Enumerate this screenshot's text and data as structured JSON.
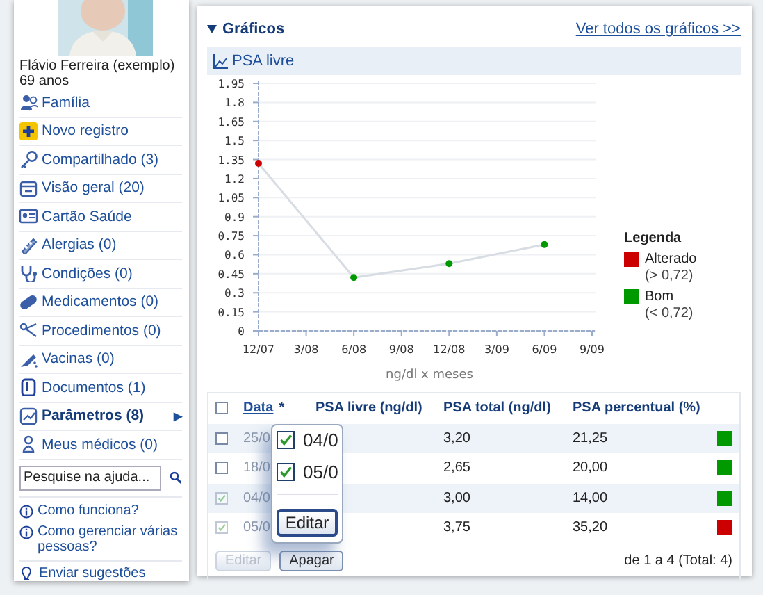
{
  "profile": {
    "name": "Flávio Ferreira (exemplo)",
    "age": "69 anos"
  },
  "nav": [
    {
      "label": "Família",
      "selected": false
    },
    {
      "label": "Novo registro",
      "selected": false
    },
    {
      "label": "Compartilhado (3)",
      "selected": false
    },
    {
      "label": "Visão geral (20)",
      "selected": false
    },
    {
      "label": "Cartão Saúde",
      "selected": false
    },
    {
      "label": "Alergias (0)",
      "selected": false
    },
    {
      "label": "Condições (0)",
      "selected": false
    },
    {
      "label": "Medicamentos (0)",
      "selected": false
    },
    {
      "label": "Procedimentos (0)",
      "selected": false
    },
    {
      "label": "Vacinas (0)",
      "selected": false
    },
    {
      "label": "Documentos (1)",
      "selected": false
    },
    {
      "label": "Parâmetros (8)",
      "selected": true,
      "marker": "▶"
    },
    {
      "label": "Meus médicos (0)",
      "selected": false
    }
  ],
  "help_search": {
    "placeholder": "Pesquise na ajuda..."
  },
  "help_links": [
    "Como funciona?",
    "Como gerenciar várias pessoas?"
  ],
  "feedback_link": "Enviar sugestões",
  "section": {
    "title": "Gráficos",
    "expanded": true,
    "link": "Ver todos os gráficos >>"
  },
  "chart": {
    "chart_data": {
      "type": "line",
      "xlabel": "ng/dl x meses",
      "grid": true,
      "categories": [
        "12/07",
        "3/08",
        "6/08",
        "9/08",
        "12/08",
        "3/09",
        "6/09",
        "9/09"
      ],
      "series": [
        {
          "name": "PSA livre",
          "color": "#d8dde4",
          "marker": true,
          "values": [
            1.32,
            null,
            0.42,
            null,
            0.53,
            null,
            0.68,
            null
          ]
        }
      ],
      "ylim": [
        0,
        1.95
      ],
      "yticks": [
        {
          "value": 0,
          "label": "0"
        },
        {
          "value": 0.15,
          "label": "0.15"
        },
        {
          "value": 0.3,
          "label": "0.3"
        },
        {
          "value": 0.45,
          "label": "0.45"
        },
        {
          "value": 0.6,
          "label": "0.6"
        },
        {
          "value": 0.75,
          "label": "0.75"
        },
        {
          "value": 0.9,
          "label": "0.9"
        },
        {
          "value": 1.05,
          "label": "1.05"
        },
        {
          "value": 1.2,
          "label": "1.2"
        },
        {
          "value": 1.35,
          "label": "1.35"
        },
        {
          "value": 1.5,
          "label": "1.5"
        },
        {
          "value": 1.65,
          "label": "1.65"
        },
        {
          "value": 1.8,
          "label": "1.8"
        },
        {
          "value": 1.95,
          "label": "1.95"
        }
      ]
    },
    "points": [
      {
        "kind": "altered"
      },
      {
        "kind": "good"
      },
      {
        "kind": "good"
      },
      {
        "kind": "good"
      }
    ],
    "legend": {
      "title": "Legenda",
      "items": [
        {
          "kind": "altered",
          "label": "Alterado",
          "note": "(> 0,72)",
          "color": "#cc0000"
        },
        {
          "kind": "good",
          "label": "Bom",
          "note": "(< 0,72)",
          "color": "#009900"
        }
      ]
    }
  },
  "table": {
    "select_all": false,
    "columns": [
      "Data",
      "*",
      "PSA livre (ng/dl)",
      "PSA total (ng/dl)",
      "PSA percentual (%)"
    ],
    "rows": [
      {
        "checked": false,
        "date": "25/0",
        "total": "3,20",
        "percent": "21,25",
        "color": "#009900"
      },
      {
        "checked": false,
        "date": "18/0",
        "total": "2,65",
        "percent": "20,00",
        "color": "#009900"
      },
      {
        "checked": true,
        "date": "04/0",
        "total": "3,00",
        "percent": "14,00",
        "color": "#009900"
      },
      {
        "checked": true,
        "date": "05/0",
        "total": "3,75",
        "percent": "35,20",
        "color": "#cc0000"
      }
    ],
    "buttons": [
      {
        "label": "Editar",
        "disabled": true
      },
      {
        "label": "Apagar",
        "disabled": false
      }
    ],
    "pager": "de 1 a 4 (Total: 4)"
  },
  "magnifier": {
    "rows": [
      {
        "checked": true,
        "date": "04/0"
      },
      {
        "checked": true,
        "date": "05/0"
      }
    ],
    "button": "Editar"
  }
}
